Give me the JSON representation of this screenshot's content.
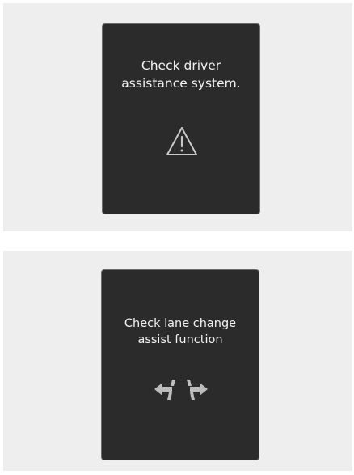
{
  "warnings": [
    {
      "message": "Check driver\nassistance system.",
      "icon": "warning-triangle-icon",
      "icon_color": "#c9c9c9"
    },
    {
      "message": "Check lane change\nassist function",
      "icon": "lane-change-arrows-icon",
      "icon_color": "#bdbdbd"
    }
  ],
  "colors": {
    "panel_background": "#eeeeee",
    "screen_background": "#2b2b2b",
    "screen_border": "#6a6a6a",
    "text": "#f2f2f2"
  }
}
